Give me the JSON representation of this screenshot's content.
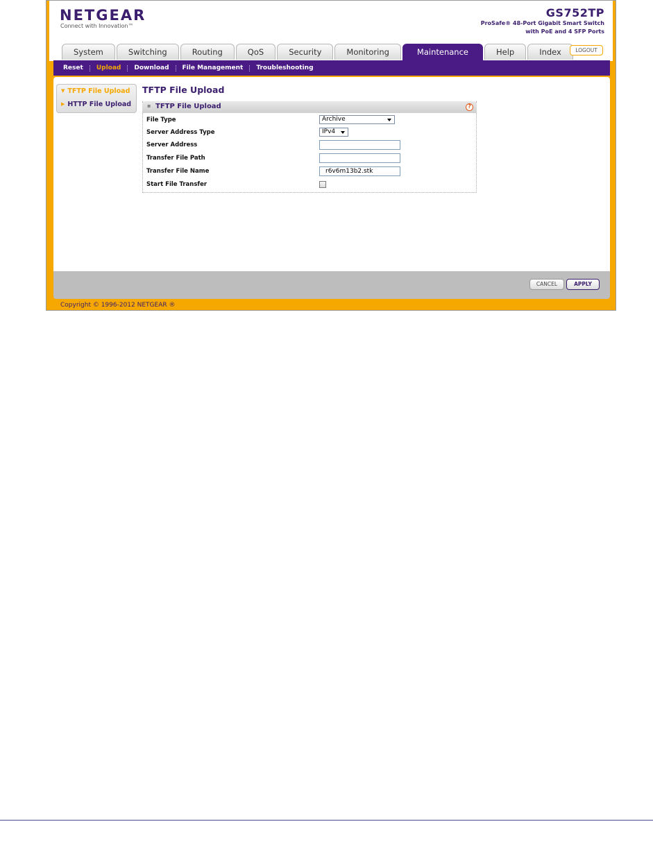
{
  "brand": {
    "logo_text": "NETGEAR",
    "tagline": "Connect with Innovation™"
  },
  "device": {
    "model": "GS752TP",
    "description_line1": "ProSafe® 48-Port Gigabit Smart Switch",
    "description_line2": "with PoE and 4 SFP Ports"
  },
  "tabs": [
    {
      "label": "System"
    },
    {
      "label": "Switching"
    },
    {
      "label": "Routing"
    },
    {
      "label": "QoS"
    },
    {
      "label": "Security"
    },
    {
      "label": "Monitoring"
    },
    {
      "label": "Maintenance",
      "active": true
    },
    {
      "label": "Help"
    },
    {
      "label": "Index"
    }
  ],
  "logout_label": "LOGOUT",
  "subnav": [
    {
      "label": "Reset"
    },
    {
      "label": "Upload",
      "active": true
    },
    {
      "label": "Download"
    },
    {
      "label": "File Management"
    },
    {
      "label": "Troubleshooting"
    }
  ],
  "leftnav": [
    {
      "label": "TFTP File Upload",
      "active": true
    },
    {
      "label": "HTTP File Upload"
    }
  ],
  "page_title": "TFTP File Upload",
  "panel": {
    "title": "TFTP File Upload",
    "help_glyph": "?",
    "fields": {
      "file_type": {
        "label": "File Type",
        "value": "Archive"
      },
      "server_address_type": {
        "label": "Server Address Type",
        "value": "IPv4"
      },
      "server_address": {
        "label": "Server Address",
        "value": ""
      },
      "transfer_file_path": {
        "label": "Transfer File Path",
        "value": ""
      },
      "transfer_file_name": {
        "label": "Transfer File Name",
        "value": "r6v6m13b2.stk"
      },
      "start_file_transfer": {
        "label": "Start File Transfer",
        "checked": false
      }
    }
  },
  "buttons": {
    "cancel": "CANCEL",
    "apply": "APPLY"
  },
  "copyright": "Copyright © 1996-2012 NETGEAR ®",
  "colors": {
    "brand_purple": "#4a1b84",
    "accent_orange": "#f6a800",
    "footer_gray": "#bdbdbd"
  }
}
